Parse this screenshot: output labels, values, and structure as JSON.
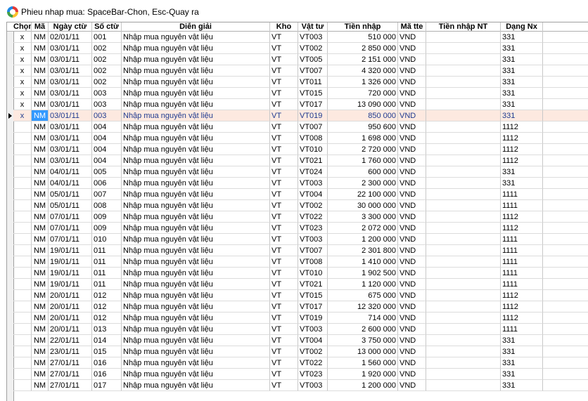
{
  "window": {
    "title": "Phieu nhap mua: SpaceBar-Chon, Esc-Quay ra",
    "icon": "app-logo-icon"
  },
  "columns": [
    {
      "key": "chon",
      "label": "Chọn"
    },
    {
      "key": "ma",
      "label": "Mã"
    },
    {
      "key": "ngay",
      "label": "Ngày ctừ"
    },
    {
      "key": "so",
      "label": "Số ctừ"
    },
    {
      "key": "dien",
      "label": "Diễn giải"
    },
    {
      "key": "kho",
      "label": "Kho"
    },
    {
      "key": "vattu",
      "label": "Vật tư"
    },
    {
      "key": "tien",
      "label": "Tiền nhập"
    },
    {
      "key": "matte",
      "label": "Mã tte"
    },
    {
      "key": "tiennt",
      "label": "Tiền nhập NT"
    },
    {
      "key": "dang",
      "label": "Dạng Nx"
    },
    {
      "key": "extra",
      "label": ""
    }
  ],
  "selected_row": 7,
  "rows": [
    {
      "chon": "x",
      "ma": "NM",
      "ngay": "02/01/11",
      "so": "001",
      "dien": "Nhập mua nguyên vật liệu",
      "kho": "VT",
      "vattu": "VT003",
      "tien": "510 000",
      "matte": "VND",
      "tiennt": "",
      "dang": "331"
    },
    {
      "chon": "x",
      "ma": "NM",
      "ngay": "03/01/11",
      "so": "002",
      "dien": "Nhập mua nguyên vật liệu",
      "kho": "VT",
      "vattu": "VT002",
      "tien": "2 850 000",
      "matte": "VND",
      "tiennt": "",
      "dang": "331"
    },
    {
      "chon": "x",
      "ma": "NM",
      "ngay": "03/01/11",
      "so": "002",
      "dien": "Nhập mua nguyên vật liệu",
      "kho": "VT",
      "vattu": "VT005",
      "tien": "2 151 000",
      "matte": "VND",
      "tiennt": "",
      "dang": "331"
    },
    {
      "chon": "x",
      "ma": "NM",
      "ngay": "03/01/11",
      "so": "002",
      "dien": "Nhập mua nguyên vật liệu",
      "kho": "VT",
      "vattu": "VT007",
      "tien": "4 320 000",
      "matte": "VND",
      "tiennt": "",
      "dang": "331"
    },
    {
      "chon": "x",
      "ma": "NM",
      "ngay": "03/01/11",
      "so": "002",
      "dien": "Nhập mua nguyên vật liệu",
      "kho": "VT",
      "vattu": "VT011",
      "tien": "1 326 000",
      "matte": "VND",
      "tiennt": "",
      "dang": "331"
    },
    {
      "chon": "x",
      "ma": "NM",
      "ngay": "03/01/11",
      "so": "003",
      "dien": "Nhập mua nguyên vật liệu",
      "kho": "VT",
      "vattu": "VT015",
      "tien": "720 000",
      "matte": "VND",
      "tiennt": "",
      "dang": "331"
    },
    {
      "chon": "x",
      "ma": "NM",
      "ngay": "03/01/11",
      "so": "003",
      "dien": "Nhập mua nguyên vật liệu",
      "kho": "VT",
      "vattu": "VT017",
      "tien": "13 090 000",
      "matte": "VND",
      "tiennt": "",
      "dang": "331"
    },
    {
      "chon": "x",
      "ma": "NM",
      "ngay": "03/01/11",
      "so": "003",
      "dien": "Nhập mua nguyên vật liệu",
      "kho": "VT",
      "vattu": "VT019",
      "tien": "850 000",
      "matte": "VND",
      "tiennt": "",
      "dang": "331"
    },
    {
      "chon": "",
      "ma": "NM",
      "ngay": "03/01/11",
      "so": "004",
      "dien": "Nhập mua nguyên vật liệu",
      "kho": "VT",
      "vattu": "VT007",
      "tien": "950 600",
      "matte": "VND",
      "tiennt": "",
      "dang": "1112"
    },
    {
      "chon": "",
      "ma": "NM",
      "ngay": "03/01/11",
      "so": "004",
      "dien": "Nhập mua nguyên vật liệu",
      "kho": "VT",
      "vattu": "VT008",
      "tien": "1 698 000",
      "matte": "VND",
      "tiennt": "",
      "dang": "1112"
    },
    {
      "chon": "",
      "ma": "NM",
      "ngay": "03/01/11",
      "so": "004",
      "dien": "Nhập mua nguyên vật liệu",
      "kho": "VT",
      "vattu": "VT010",
      "tien": "2 720 000",
      "matte": "VND",
      "tiennt": "",
      "dang": "1112"
    },
    {
      "chon": "",
      "ma": "NM",
      "ngay": "03/01/11",
      "so": "004",
      "dien": "Nhập mua nguyên vật liệu",
      "kho": "VT",
      "vattu": "VT021",
      "tien": "1 760 000",
      "matte": "VND",
      "tiennt": "",
      "dang": "1112"
    },
    {
      "chon": "",
      "ma": "NM",
      "ngay": "04/01/11",
      "so": "005",
      "dien": "Nhập mua nguyên vật liệu",
      "kho": "VT",
      "vattu": "VT024",
      "tien": "600 000",
      "matte": "VND",
      "tiennt": "",
      "dang": "331"
    },
    {
      "chon": "",
      "ma": "NM",
      "ngay": "04/01/11",
      "so": "006",
      "dien": "Nhập mua nguyên vật liệu",
      "kho": "VT",
      "vattu": "VT003",
      "tien": "2 300 000",
      "matte": "VND",
      "tiennt": "",
      "dang": "331"
    },
    {
      "chon": "",
      "ma": "NM",
      "ngay": "05/01/11",
      "so": "007",
      "dien": "Nhập mua nguyên vật liệu",
      "kho": "VT",
      "vattu": "VT004",
      "tien": "22 100 000",
      "matte": "VND",
      "tiennt": "",
      "dang": "1111"
    },
    {
      "chon": "",
      "ma": "NM",
      "ngay": "05/01/11",
      "so": "008",
      "dien": "Nhập mua nguyên vật liệu",
      "kho": "VT",
      "vattu": "VT002",
      "tien": "30 000 000",
      "matte": "VND",
      "tiennt": "",
      "dang": "1111"
    },
    {
      "chon": "",
      "ma": "NM",
      "ngay": "07/01/11",
      "so": "009",
      "dien": "Nhập mua nguyên vật liệu",
      "kho": "VT",
      "vattu": "VT022",
      "tien": "3 300 000",
      "matte": "VND",
      "tiennt": "",
      "dang": "1112"
    },
    {
      "chon": "",
      "ma": "NM",
      "ngay": "07/01/11",
      "so": "009",
      "dien": "Nhập mua nguyên vật liệu",
      "kho": "VT",
      "vattu": "VT023",
      "tien": "2 072 000",
      "matte": "VND",
      "tiennt": "",
      "dang": "1112"
    },
    {
      "chon": "",
      "ma": "NM",
      "ngay": "07/01/11",
      "so": "010",
      "dien": "Nhập mua nguyên vật liệu",
      "kho": "VT",
      "vattu": "VT003",
      "tien": "1 200 000",
      "matte": "VND",
      "tiennt": "",
      "dang": "1111"
    },
    {
      "chon": "",
      "ma": "NM",
      "ngay": "19/01/11",
      "so": "011",
      "dien": "Nhập mua nguyên vật liệu",
      "kho": "VT",
      "vattu": "VT007",
      "tien": "2 301 800",
      "matte": "VND",
      "tiennt": "",
      "dang": "1111"
    },
    {
      "chon": "",
      "ma": "NM",
      "ngay": "19/01/11",
      "so": "011",
      "dien": "Nhập mua nguyên vật liệu",
      "kho": "VT",
      "vattu": "VT008",
      "tien": "1 410 000",
      "matte": "VND",
      "tiennt": "",
      "dang": "1111"
    },
    {
      "chon": "",
      "ma": "NM",
      "ngay": "19/01/11",
      "so": "011",
      "dien": "Nhập mua nguyên vật liệu",
      "kho": "VT",
      "vattu": "VT010",
      "tien": "1 902 500",
      "matte": "VND",
      "tiennt": "",
      "dang": "1111"
    },
    {
      "chon": "",
      "ma": "NM",
      "ngay": "19/01/11",
      "so": "011",
      "dien": "Nhập mua nguyên vật liệu",
      "kho": "VT",
      "vattu": "VT021",
      "tien": "1 120 000",
      "matte": "VND",
      "tiennt": "",
      "dang": "1111"
    },
    {
      "chon": "",
      "ma": "NM",
      "ngay": "20/01/11",
      "so": "012",
      "dien": "Nhập mua nguyên vật liệu",
      "kho": "VT",
      "vattu": "VT015",
      "tien": "675 000",
      "matte": "VND",
      "tiennt": "",
      "dang": "1112"
    },
    {
      "chon": "",
      "ma": "NM",
      "ngay": "20/01/11",
      "so": "012",
      "dien": "Nhập mua nguyên vật liệu",
      "kho": "VT",
      "vattu": "VT017",
      "tien": "12 320 000",
      "matte": "VND",
      "tiennt": "",
      "dang": "1112"
    },
    {
      "chon": "",
      "ma": "NM",
      "ngay": "20/01/11",
      "so": "012",
      "dien": "Nhập mua nguyên vật liệu",
      "kho": "VT",
      "vattu": "VT019",
      "tien": "714 000",
      "matte": "VND",
      "tiennt": "",
      "dang": "1112"
    },
    {
      "chon": "",
      "ma": "NM",
      "ngay": "20/01/11",
      "so": "013",
      "dien": "Nhập mua nguyên vật liệu",
      "kho": "VT",
      "vattu": "VT003",
      "tien": "2 600 000",
      "matte": "VND",
      "tiennt": "",
      "dang": "1111"
    },
    {
      "chon": "",
      "ma": "NM",
      "ngay": "22/01/11",
      "so": "014",
      "dien": "Nhập mua nguyên vật liệu",
      "kho": "VT",
      "vattu": "VT004",
      "tien": "3 750 000",
      "matte": "VND",
      "tiennt": "",
      "dang": "331"
    },
    {
      "chon": "",
      "ma": "NM",
      "ngay": "23/01/11",
      "so": "015",
      "dien": "Nhập mua nguyên vật liệu",
      "kho": "VT",
      "vattu": "VT002",
      "tien": "13 000 000",
      "matte": "VND",
      "tiennt": "",
      "dang": "331"
    },
    {
      "chon": "",
      "ma": "NM",
      "ngay": "27/01/11",
      "so": "016",
      "dien": "Nhập mua nguyên vật liệu",
      "kho": "VT",
      "vattu": "VT022",
      "tien": "1 560 000",
      "matte": "VND",
      "tiennt": "",
      "dang": "331"
    },
    {
      "chon": "",
      "ma": "NM",
      "ngay": "27/01/11",
      "so": "016",
      "dien": "Nhập mua nguyên vật liệu",
      "kho": "VT",
      "vattu": "VT023",
      "tien": "1 920 000",
      "matte": "VND",
      "tiennt": "",
      "dang": "331"
    },
    {
      "chon": "",
      "ma": "NM",
      "ngay": "27/01/11",
      "so": "017",
      "dien": "Nhập mua nguyên vật liệu",
      "kho": "VT",
      "vattu": "VT003",
      "tien": "1 200 000",
      "matte": "VND",
      "tiennt": "",
      "dang": "331"
    }
  ]
}
